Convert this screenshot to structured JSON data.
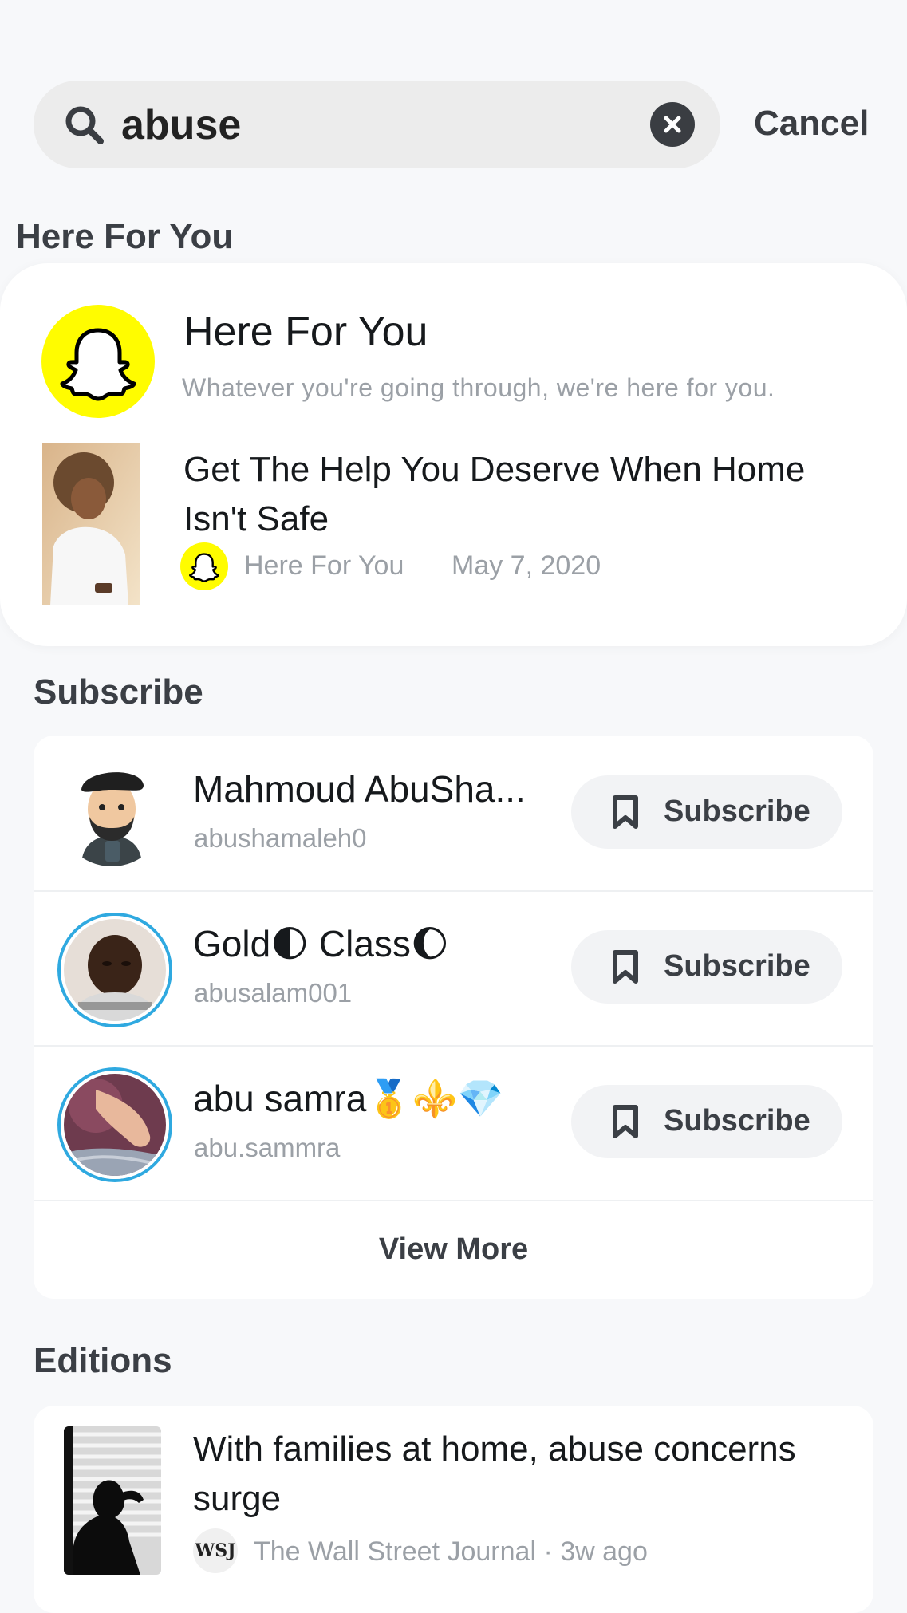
{
  "search": {
    "query": "abuse",
    "cancel_label": "Cancel"
  },
  "here_for_you": {
    "section_title": "Here For You",
    "publisher_name": "Here For You",
    "tagline": "Whatever you're going through, we're here for you.",
    "story": {
      "title": "Get The Help You Deserve When Home Isn't Safe",
      "publisher": "Here For You",
      "date": "May 7, 2020"
    }
  },
  "subscribe": {
    "section_title": "Subscribe",
    "items": [
      {
        "name": "Mahmoud AbuSha...",
        "handle": "abushamaleh0",
        "button": "Subscribe"
      },
      {
        "name": "Gold🌓 Class🌔",
        "handle": "abusalam001",
        "button": "Subscribe"
      },
      {
        "name": "abu samra🥇⚜️💎",
        "handle": "abu.sammra",
        "button": "Subscribe"
      }
    ],
    "view_more": "View More"
  },
  "editions": {
    "section_title": "Editions",
    "items": [
      {
        "title": "With families at home, abuse concerns surge",
        "publisher_logo_text": "WSJ",
        "meta": "The Wall Street Journal · 3w ago"
      }
    ]
  },
  "colors": {
    "snap_yellow": "#fffc00",
    "story_ring": "#2fa9e0",
    "muted_text": "#9ba0a6"
  }
}
